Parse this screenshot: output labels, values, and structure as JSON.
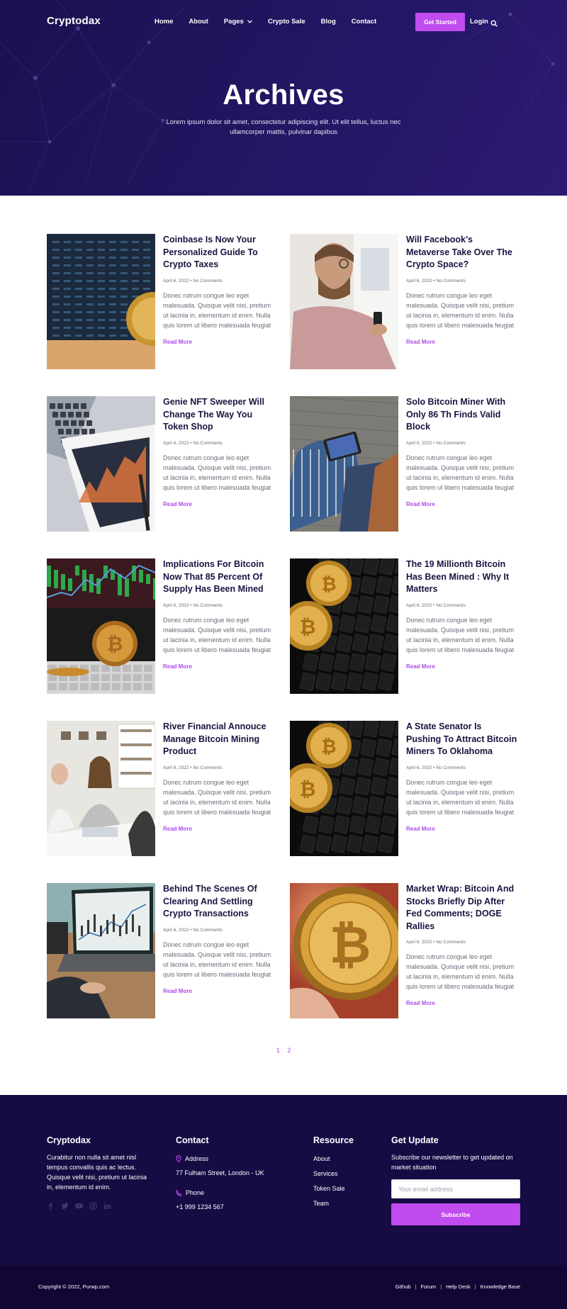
{
  "header": {
    "logo": "Cryptodax",
    "nav": [
      "Home",
      "About",
      "Pages",
      "Crypto Sale",
      "Blog",
      "Contact"
    ],
    "cta": "Get Started",
    "login": "Login"
  },
  "hero": {
    "title": "Archives",
    "subtitle": "Lorem ipsum dolor sit amet, consectetur adipiscing elit. Ut elit tellus, luctus nec ullamcorper mattis, pulvinar dapibus"
  },
  "posts": [
    {
      "title": "Coinbase Is Now Your Personalized Guide To Crypto Taxes",
      "meta": "April 6, 2022 • No Comments",
      "excerpt": "Donec rutrum congue leo eget malesuada. Quisque velit nisi, pretium ut lacinia in, elementum id enim. Nulla quis lorem ut libero malesuada feugiat",
      "more": "Read More",
      "image": "bitcoin-chart-photo"
    },
    {
      "title": "Will Facebook’s Metaverse Take Over The Crypto Space?",
      "meta": "April 6, 2022 • No Comments",
      "excerpt": "Donec rutrum congue leo eget malesuada. Quisque velit nisi, pretium ut lacinia in, elementum id enim. Nulla quis lorem ut libero malesuada feugiat",
      "more": "Read More",
      "image": "man-with-phone-photo"
    },
    {
      "title": "Genie NFT Sweeper Will Change The Way You Token Shop",
      "meta": "April 6, 2022 • No Comments",
      "excerpt": "Donec rutrum congue leo eget malesuada. Quisque velit nisi, pretium ut lacinia in, elementum id enim. Nulla quis lorem ut libero malesuada feugiat",
      "more": "Read More",
      "image": "tablet-chart-photo"
    },
    {
      "title": "Solo Bitcoin Miner With Only 86 Th Finds Valid Block",
      "meta": "April 6, 2022 • No Comments",
      "excerpt": "Donec rutrum congue leo eget malesuada. Quisque velit nisi, pretium ut lacinia in, elementum id enim. Nulla quis lorem ut libero malesuada feugiat",
      "more": "Read More",
      "image": "man-with-tablet-photo"
    },
    {
      "title": "Implications For Bitcoin Now That 85 Percent Of Supply Has Been Mined",
      "meta": "April 6, 2022 • No Comments",
      "excerpt": "Donec rutrum congue leo eget malesuada. Quisque velit nisi, pretium ut lacinia in, elementum id enim. Nulla quis lorem ut libero malesuada feugiat",
      "more": "Read More",
      "image": "bitcoin-keyboard-photo"
    },
    {
      "title": "The 19 Millionth Bitcoin Has Been Mined : Why It Matters",
      "meta": "April 6, 2022 • No Comments",
      "excerpt": "Donec rutrum congue leo eget malesuada. Quisque velit nisi, pretium ut lacinia in, elementum id enim. Nulla quis lorem ut libero malesuada feugiat",
      "more": "Read More",
      "image": "coins-on-keyboard-photo"
    },
    {
      "title": "River Financial Annouce Manage Bitcoin Mining Product",
      "meta": "April 6, 2022 • No Comments",
      "excerpt": "Donec rutrum congue leo eget malesuada. Quisque velit nisi, pretium ut lacinia in, elementum id enim. Nulla quis lorem ut libero malesuada feugiat",
      "more": "Read More",
      "image": "office-meeting-photo"
    },
    {
      "title": "A State Senator Is Pushing To Attract Bitcoin Miners To Oklahoma",
      "meta": "April 6, 2022 • No Comments",
      "excerpt": "Donec rutrum congue leo eget malesuada. Quisque velit nisi, pretium ut lacinia in, elementum id enim. Nulla quis lorem ut libero malesuada feugiat",
      "more": "Read More",
      "image": "coins-on-keyboard-photo"
    },
    {
      "title": "Behind The Scenes Of Clearing And Settling Crypto Transactions",
      "meta": "April 6, 2022 • No Comments",
      "excerpt": "Donec rutrum congue leo eget malesuada. Quisque velit nisi, pretium ut lacinia in, elementum id enim. Nulla quis lorem ut libero malesuada feugiat",
      "more": "Read More",
      "image": "laptop-trading-photo"
    },
    {
      "title": "Market Wrap: Bitcoin And Stocks Briefly Dip After Fed Comments; DOGE Rallies",
      "meta": "April 6, 2022 • No Comments",
      "excerpt": "Donec rutrum congue leo eget malesuada. Quisque velit nisi, pretium ut lacinia in, elementum id enim. Nulla quis lorem ut libero malesuada feugiat",
      "more": "Read More",
      "image": "bitcoin-in-hand-photo"
    }
  ],
  "pagination": [
    "1",
    "2"
  ],
  "footer": {
    "brand": "Cryptodax",
    "about": "Curabitur non nulla sit amet nisl tempus convallis quis ac lectus. Quisque velit nisi, pretium ut lacinia in, elementum id enim.",
    "socials": [
      "facebook-icon",
      "twitter-icon",
      "youtube-icon",
      "instagram-icon",
      "linkedin-icon"
    ],
    "contact_title": "Contact",
    "address_label": "Address",
    "address": "77 Fulham Street, London - UK",
    "phone_label": "Phone",
    "phone": "+1 999 1234 567",
    "resource_title": "Resource",
    "resources": [
      "About",
      "Services",
      "Token Sale",
      "Team"
    ],
    "update_title": "Get Update",
    "update_text": "Subscribe our newsletter to get updated on market situation",
    "email_placeholder": "Your email address",
    "subscribe": "Subscribe",
    "copyright": "Copyright © 2022, Purwp.com",
    "bottom_links": [
      "Github",
      "Forum",
      "Help Desk",
      "Knowledge Base"
    ]
  },
  "colors": {
    "accent": "#c04cf0",
    "hero": "#1b1150",
    "footer": "#170b44",
    "text": "#1b1340"
  }
}
